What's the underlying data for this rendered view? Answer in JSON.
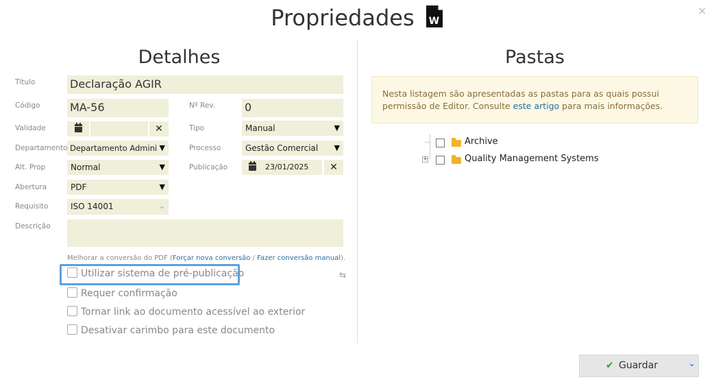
{
  "modal": {
    "title": "Propriedades",
    "doc_icon_letter": "W",
    "close": "×"
  },
  "details": {
    "heading": "Detalhes",
    "titulo_label": "Título",
    "titulo_value": "Declaração AGIR",
    "codigo_label": "Código",
    "codigo_value": "MA-56",
    "nrev_label": "Nº Rev.",
    "nrev_value": "0",
    "validade_label": "Validade",
    "validade_value": "",
    "tipo_label": "Tipo",
    "tipo_value": "Manual",
    "departamento_label": "Departamento",
    "departamento_value": "Departamento Admini",
    "processo_label": "Processo",
    "processo_value": "Gestão Comercial",
    "altprop_label": "Alt. Prop",
    "altprop_value": "Normal",
    "publicacao_label": "Publicação",
    "publicacao_value": "23/01/2025",
    "abertura_label": "Abertura",
    "abertura_value": "PDF",
    "requisito_label": "Requisito",
    "requisito_value": "ISO 14001",
    "descricao_label": "Descrição",
    "descricao_value": "",
    "hint_prefix": "Melhorar a conversão do PDF (",
    "hint_link1": "Forçar nova conversão",
    "hint_sep": " / ",
    "hint_link2": "Fazer conversão manual",
    "hint_suffix": ").",
    "options": [
      {
        "label": "Utilizar sistema de pré-publicação",
        "checked": false
      },
      {
        "label": "Requer confirmação",
        "checked": false
      },
      {
        "label": "Tornar link ao documento acessível ao exterior",
        "checked": false
      },
      {
        "label": "Desativar carimbo para este documento",
        "checked": false
      }
    ]
  },
  "folders": {
    "heading": "Pastas",
    "info_text_1": "Nesta listagem são apresentadas as pastas para as quais possui permissão de Editor. Consulte ",
    "info_link": "este artigo",
    "info_text_2": " para mais informações.",
    "tree": [
      {
        "label": "Archive",
        "checked": false,
        "expandable": false
      },
      {
        "label": "Quality Management Systems",
        "checked": false,
        "expandable": true
      }
    ]
  },
  "footer": {
    "save_label": "Guardar"
  },
  "colors": {
    "field_bg": "#efefda",
    "focus": "#5ba0e0",
    "info_bg": "#fcf8e3",
    "link": "#2a6fa0",
    "folder": "#f0b429",
    "check_green": "#3a9a3a"
  }
}
